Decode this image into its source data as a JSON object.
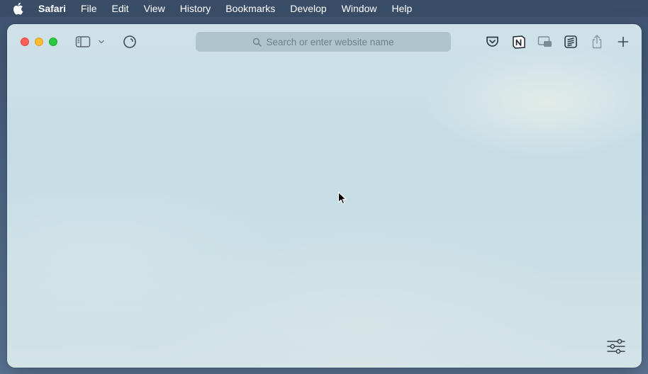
{
  "menubar": {
    "app_name": "Safari",
    "items": [
      "File",
      "Edit",
      "View",
      "History",
      "Bookmarks",
      "Develop",
      "Window",
      "Help"
    ]
  },
  "toolbar": {
    "address_placeholder": "Search or enter website name",
    "icons": [
      "sidebar-icon",
      "chevron-down-icon",
      "privacy-icon",
      "pocket-icon",
      "notion-icon",
      "picture-in-picture-icon",
      "reader-list-icon",
      "share-icon",
      "add-tab-icon"
    ]
  },
  "content": {
    "bottom_icon": "customize-start-page-icon"
  }
}
